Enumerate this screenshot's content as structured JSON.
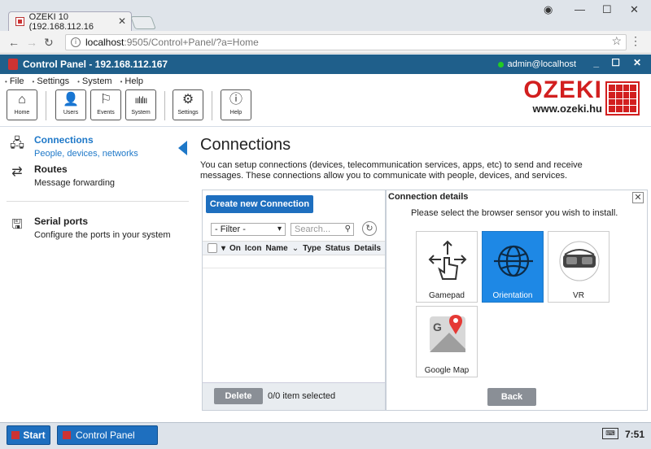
{
  "browser": {
    "tab_title": "OZEKI 10 (192.168.112.16",
    "url_host": "localhost",
    "url_path": ":9505/Control+Panel/?a=Home"
  },
  "app": {
    "title": "Control Panel - 192.168.112.167",
    "user": "admin@localhost",
    "accent": "#1f5f8b"
  },
  "menu": [
    "File",
    "Settings",
    "System",
    "Help"
  ],
  "toolbar": [
    {
      "label": "Home",
      "icon": "home-icon"
    },
    {
      "label": "Users",
      "icon": "user-icon"
    },
    {
      "label": "Events",
      "icon": "events-icon"
    },
    {
      "label": "System",
      "icon": "system-icon"
    },
    {
      "label": "Settings",
      "icon": "gear-icon"
    },
    {
      "label": "Help",
      "icon": "info-icon"
    }
  ],
  "brand": {
    "name": "OZEKI",
    "url": "www.ozeki.hu",
    "color": "#d21f1f"
  },
  "sidebar": [
    {
      "title": "Connections",
      "desc": "People, devices, networks",
      "active": true
    },
    {
      "title": "Routes",
      "desc": "Message forwarding",
      "active": false
    },
    {
      "title": "Serial ports",
      "desc": "Configure the ports in your system",
      "active": false
    }
  ],
  "main": {
    "title": "Connections",
    "description": "You can setup connections (devices, telecommunication services, apps, etc) to send and receive messages. These connections allow you to communicate with people, devices, and services."
  },
  "connections": {
    "create_label": "Create new Connection",
    "filter_value": "- Filter -",
    "search_placeholder": "Search...",
    "columns": [
      "On",
      "Icon",
      "Name",
      "Type",
      "Status",
      "Details"
    ],
    "delete_label": "Delete",
    "selection_text": "0/0 item selected"
  },
  "details": {
    "title": "Connection details",
    "message": "Please select the browser sensor you wish to install.",
    "tiles": [
      {
        "label": "Gamepad",
        "selected": false
      },
      {
        "label": "Orientation",
        "selected": true
      },
      {
        "label": "VR",
        "selected": false
      },
      {
        "label": "Google Map",
        "selected": false
      }
    ],
    "back_label": "Back"
  },
  "taskbar": {
    "start_label": "Start",
    "task_label": "Control Panel",
    "clock": "7:51"
  }
}
